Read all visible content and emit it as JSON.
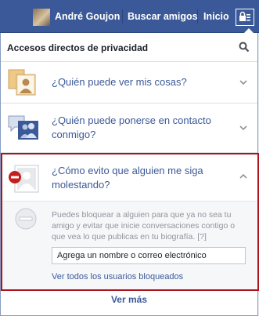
{
  "topbar": {
    "user_name": "André Goujon",
    "find_friends": "Buscar amigos",
    "home": "Inicio",
    "privacy_icon": "privacy-lock-icon"
  },
  "panel": {
    "title": "Accesos directos de privacidad",
    "search_icon": "search-icon",
    "items": [
      {
        "question": "¿Quién puede ver mis cosas?",
        "icon": "photos-lock-icon"
      },
      {
        "question": "¿Quién puede ponerse en contacto conmigo?",
        "icon": "chat-people-icon"
      },
      {
        "question": "¿Cómo evito que alguien me siga molestando?",
        "icon": "block-user-icon"
      }
    ],
    "expanded": {
      "description": "Puedes bloquear a alguien para que ya no sea tu amigo y evitar que inicie conversaciones contigo o que vea lo que publicas en tu biografía.",
      "help": "[?]",
      "input_placeholder": "Agrega un nombre o correo electrónico",
      "link": "Ver todos los usuarios bloqueados"
    },
    "see_more": "Ver más"
  },
  "colors": {
    "brand": "#3b5998",
    "highlight_border": "#b0121b",
    "link": "#3b5998"
  }
}
